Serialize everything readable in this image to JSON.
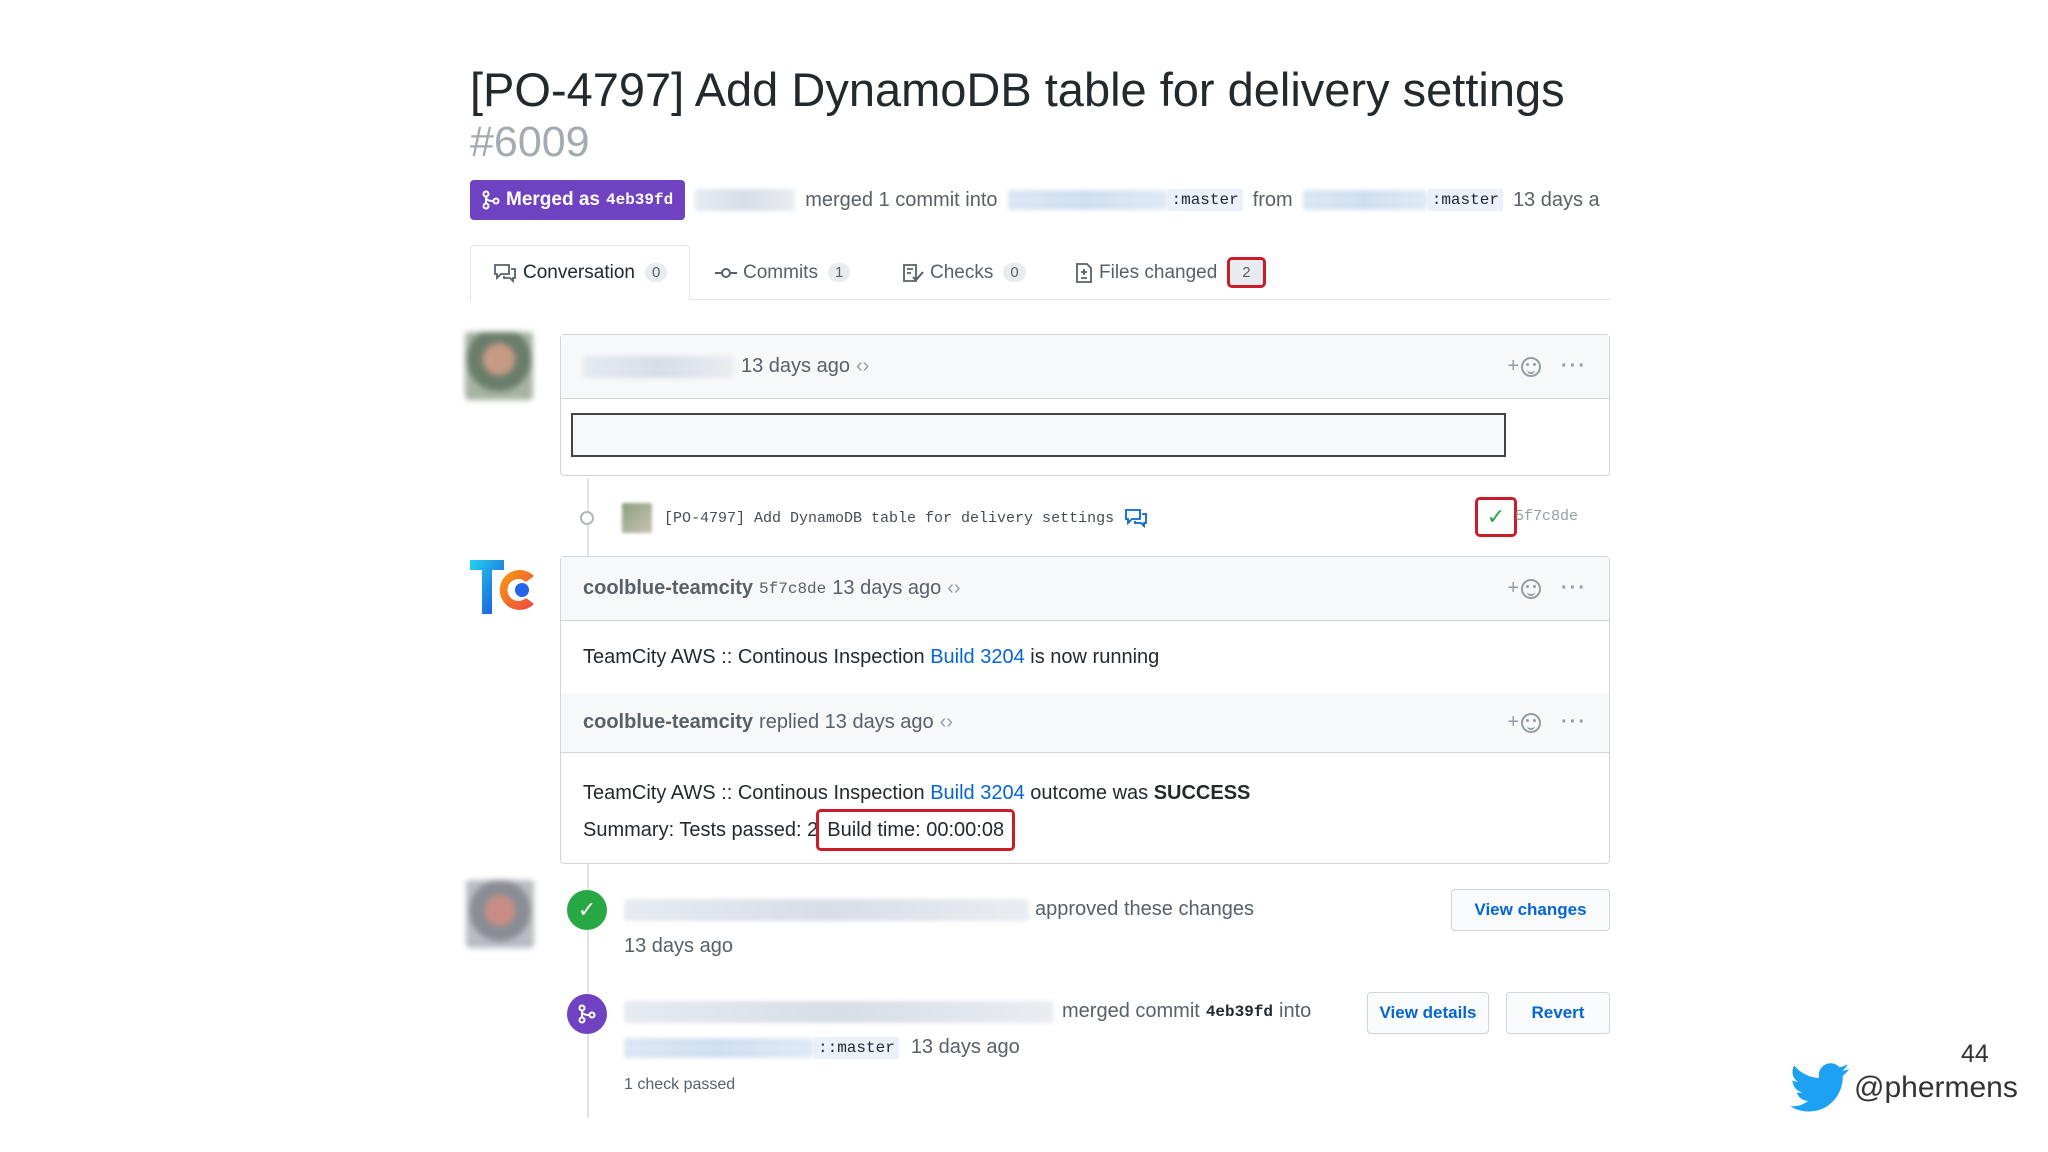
{
  "pr": {
    "title": "[PO-4797] Add DynamoDB table for delivery settings",
    "number": "#6009",
    "badge_label": "Merged as",
    "badge_sha": "4eb39fd",
    "merged_text": "merged 1 commit into",
    "target_branch": ":master",
    "from_text": "from",
    "source_branch": ":master",
    "time_text": "13 days a"
  },
  "tabs": [
    {
      "label": "Conversation",
      "count": "0"
    },
    {
      "label": "Commits",
      "count": "1"
    },
    {
      "label": "Checks",
      "count": "0"
    },
    {
      "label": "Files changed",
      "count": "2"
    }
  ],
  "comment1": {
    "time": "13 days ago",
    "code_icon": "‹›"
  },
  "commit": {
    "message": "[PO-4797] Add DynamoDB table for delivery settings",
    "sha": "5f7c8de",
    "check_icon": "✓"
  },
  "teamcity": {
    "author": "coolblue-teamcity",
    "sha": "5f7c8de",
    "time": "13 days ago",
    "body_prefix": "TeamCity AWS :: Continous Inspection",
    "build_link": "Build 3204",
    "body_suffix": "is now running",
    "reply_author": "coolblue-teamcity",
    "reply_text": "replied 13 days ago",
    "reply_prefix": "TeamCity AWS :: Continous Inspection",
    "reply_link": "Build 3204",
    "reply_outcome": "outcome was",
    "reply_status": "SUCCESS",
    "summary_prefix": "Summary: Tests passed: 2",
    "build_time": "Build time: 00:00:08"
  },
  "approval": {
    "text": "approved these changes",
    "time": "13 days ago",
    "button": "View changes"
  },
  "merge_event": {
    "text": "merged commit",
    "sha": "4eb39fd",
    "into": "into",
    "branch": "::master",
    "time": "13 days ago",
    "checks": "1 check passed",
    "details_button": "View details",
    "revert_button": "Revert"
  },
  "slide": {
    "number": "44",
    "handle": "@phermens"
  },
  "colors": {
    "merged_purple": "#6f42c1",
    "success_green": "#28a745",
    "highlight_red": "#cb1c2a",
    "link_blue": "#0366d6"
  }
}
